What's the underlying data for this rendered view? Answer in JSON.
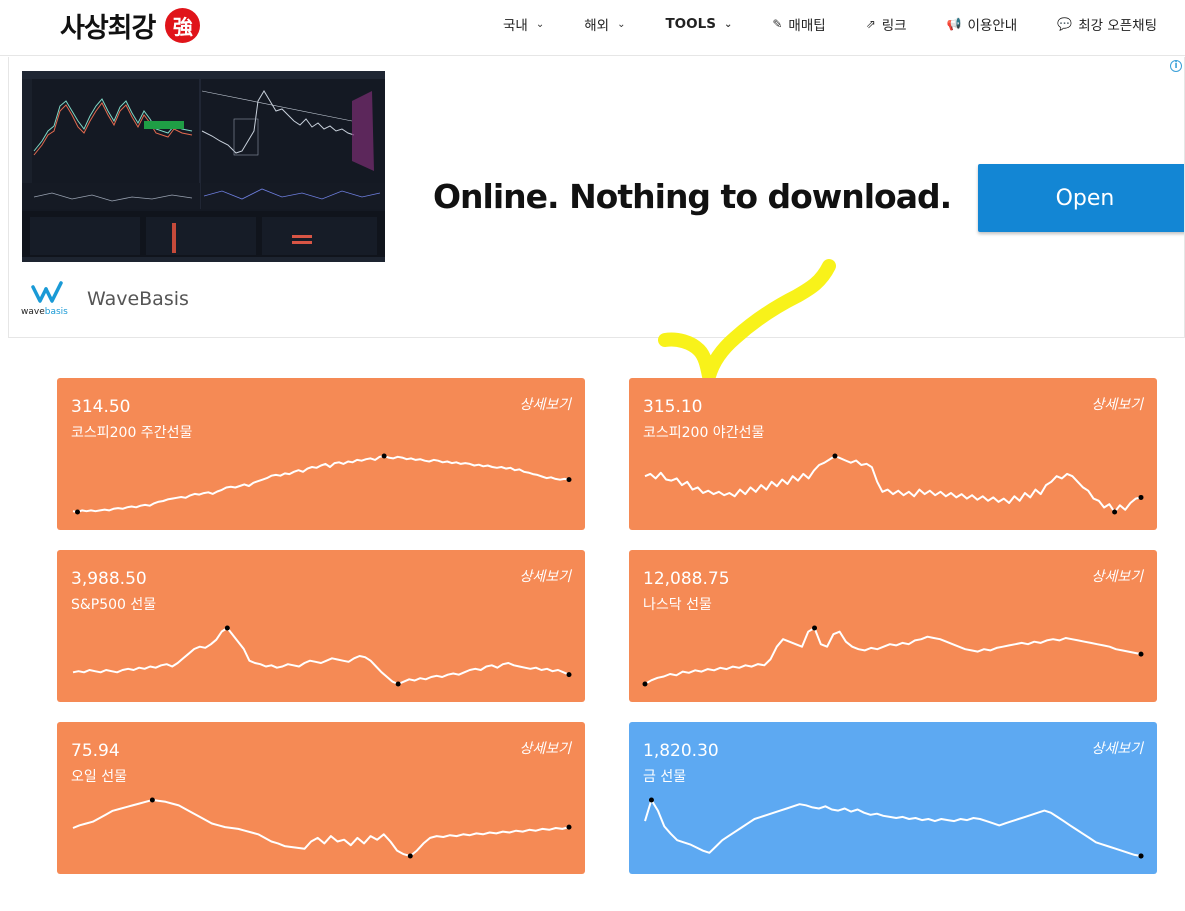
{
  "header": {
    "logo_text": "사상최강",
    "logo_seal": "強",
    "nav": [
      {
        "label": "국내",
        "icon": "",
        "dropdown": true,
        "bold": false
      },
      {
        "label": "해외",
        "icon": "",
        "dropdown": true,
        "bold": false
      },
      {
        "label": "TOOLS",
        "icon": "",
        "dropdown": true,
        "bold": true
      },
      {
        "label": "매매팁",
        "icon": "edit-icon",
        "dropdown": false,
        "bold": false
      },
      {
        "label": "링크",
        "icon": "external-link-icon",
        "dropdown": false,
        "bold": false
      },
      {
        "label": "이용안내",
        "icon": "bullhorn-icon",
        "dropdown": false,
        "bold": false
      },
      {
        "label": "최강 오픈채팅",
        "icon": "chat-icon",
        "dropdown": false,
        "bold": false
      }
    ]
  },
  "ad": {
    "headline": "Online. Nothing to download.",
    "button": "Open",
    "brand_name": "WaveBasis",
    "brand_word_a": "wave",
    "brand_word_b": "basis",
    "info_glyph": "i"
  },
  "cards": [
    {
      "price": "314.50",
      "name": "코스피200 주간선물",
      "detail": "상세보기",
      "color": "#f58a55",
      "series": [
        30,
        29,
        31,
        30,
        31,
        30,
        31,
        32,
        31,
        33,
        34,
        33,
        35,
        36,
        35,
        37,
        38,
        37,
        40,
        42,
        43,
        45,
        46,
        47,
        48,
        47,
        50,
        52,
        51,
        53,
        54,
        52,
        55,
        57,
        60,
        61,
        60,
        62,
        64,
        62,
        66,
        68,
        70,
        72,
        75,
        76,
        75,
        78,
        77,
        80,
        82,
        80,
        84,
        86,
        85,
        88,
        90,
        86,
        91,
        92,
        90,
        93,
        92,
        95,
        94,
        96,
        97,
        95,
        99,
        100,
        98,
        97,
        99,
        98,
        96,
        97,
        95,
        96,
        94,
        93,
        95,
        94,
        92,
        93,
        91,
        92,
        90,
        91,
        90,
        88,
        89,
        87,
        88,
        86,
        85,
        86,
        84,
        85,
        82,
        83,
        80,
        79,
        77,
        76,
        74,
        72,
        73,
        71,
        70,
        71,
        70
      ]
    },
    {
      "price": "315.10",
      "name": "코스피200 야간선물",
      "detail": "상세보기",
      "color": "#f58a55",
      "series": [
        60,
        62,
        58,
        63,
        57,
        56,
        58,
        52,
        55,
        48,
        50,
        45,
        47,
        44,
        46,
        43,
        45,
        42,
        48,
        44,
        50,
        46,
        52,
        48,
        55,
        51,
        57,
        53,
        60,
        56,
        62,
        58,
        65,
        70,
        72,
        75,
        78,
        76,
        74,
        72,
        74,
        70,
        71,
        68,
        55,
        46,
        48,
        44,
        47,
        43,
        46,
        42,
        48,
        44,
        47,
        43,
        46,
        42,
        45,
        41,
        44,
        40,
        43,
        39,
        42,
        38,
        41,
        37,
        40,
        36,
        42,
        38,
        45,
        41,
        48,
        44,
        52,
        55,
        60,
        58,
        62,
        60,
        55,
        50,
        47,
        40,
        38,
        32,
        35,
        28,
        34,
        30,
        36,
        40,
        41
      ]
    },
    {
      "price": "3,988.50",
      "name": "S&P500 선물",
      "detail": "상세보기",
      "color": "#f58a55",
      "series": [
        50,
        51,
        50,
        52,
        51,
        50,
        52,
        51,
        50,
        52,
        53,
        52,
        54,
        53,
        55,
        54,
        56,
        57,
        55,
        58,
        62,
        66,
        70,
        72,
        71,
        74,
        78,
        85,
        88,
        82,
        76,
        70,
        60,
        58,
        57,
        55,
        56,
        54,
        55,
        57,
        56,
        55,
        58,
        60,
        59,
        58,
        60,
        62,
        61,
        60,
        59,
        62,
        64,
        63,
        60,
        55,
        50,
        46,
        42,
        40,
        42,
        44,
        43,
        45,
        44,
        46,
        47,
        46,
        48,
        49,
        48,
        50,
        52,
        53,
        52,
        55,
        56,
        54,
        57,
        58,
        56,
        55,
        54,
        53,
        54,
        52,
        53,
        51,
        52,
        50,
        48
      ]
    },
    {
      "price": "12,088.75",
      "name": "나스닥 선물",
      "detail": "상세보기",
      "color": "#f58a55",
      "series": [
        30,
        33,
        35,
        36,
        38,
        37,
        40,
        39,
        41,
        40,
        42,
        41,
        43,
        42,
        44,
        43,
        45,
        44,
        46,
        45,
        50,
        60,
        66,
        64,
        62,
        60,
        72,
        75,
        62,
        60,
        70,
        72,
        64,
        60,
        58,
        57,
        59,
        58,
        60,
        62,
        61,
        63,
        62,
        65,
        66,
        68,
        67,
        66,
        64,
        62,
        60,
        58,
        57,
        56,
        58,
        57,
        59,
        60,
        61,
        62,
        63,
        62,
        64,
        63,
        65,
        66,
        65,
        67,
        66,
        65,
        64,
        63,
        62,
        61,
        60,
        58,
        57,
        56,
        55,
        54
      ]
    },
    {
      "price": "75.94",
      "name": "오일 선물",
      "detail": "상세보기",
      "color": "#f58a55",
      "series": [
        55,
        58,
        60,
        62,
        66,
        70,
        74,
        76,
        78,
        80,
        82,
        84,
        86,
        85,
        84,
        82,
        80,
        76,
        72,
        68,
        64,
        60,
        58,
        56,
        55,
        54,
        52,
        50,
        48,
        44,
        40,
        38,
        35,
        34,
        33,
        32,
        40,
        44,
        38,
        46,
        40,
        42,
        36,
        44,
        38,
        46,
        42,
        48,
        40,
        30,
        26,
        24,
        30,
        38,
        44,
        46,
        45,
        47,
        46,
        48,
        47,
        49,
        48,
        50,
        49,
        51,
        50,
        52,
        51,
        53,
        52,
        54,
        53,
        55,
        54,
        56
      ]
    },
    {
      "price": "1,820.30",
      "name": "금 선물",
      "detail": "상세보기",
      "color": "#5da9f2",
      "series": [
        60,
        80,
        70,
        55,
        48,
        42,
        40,
        38,
        35,
        32,
        30,
        36,
        42,
        46,
        50,
        54,
        58,
        62,
        64,
        66,
        68,
        70,
        72,
        74,
        76,
        75,
        73,
        72,
        74,
        71,
        70,
        72,
        69,
        71,
        68,
        66,
        67,
        65,
        64,
        63,
        64,
        62,
        63,
        61,
        62,
        60,
        62,
        61,
        60,
        62,
        61,
        63,
        62,
        60,
        58,
        56,
        58,
        60,
        62,
        64,
        66,
        68,
        70,
        68,
        64,
        60,
        56,
        52,
        48,
        44,
        40,
        38,
        36,
        34,
        32,
        30,
        28,
        27
      ]
    }
  ]
}
